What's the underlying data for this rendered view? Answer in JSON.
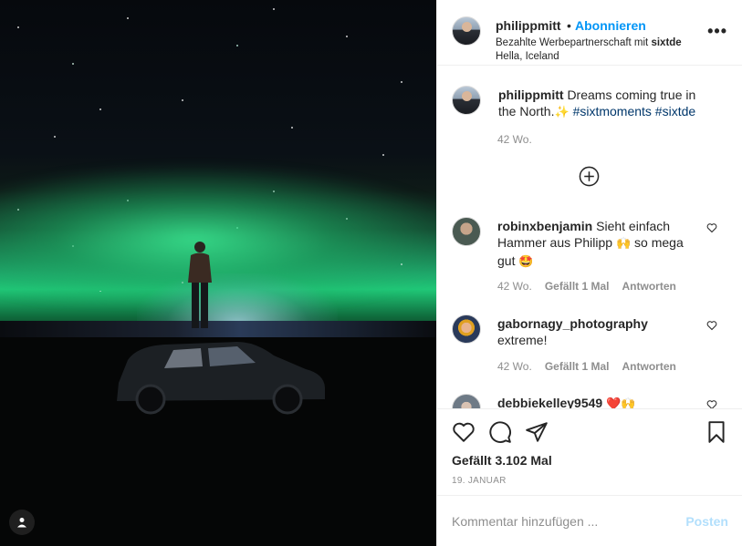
{
  "post": {
    "username": "philippmitt",
    "dot": "•",
    "follow_label": "Abonnieren",
    "sponsor_prefix": "Bezahlte Werbepartnerschaft mit",
    "sponsor": "sixtde",
    "location": "Hella, Iceland",
    "more_label": "•••",
    "caption_text": "Dreams coming true in the North.",
    "caption_emoji": "✨",
    "hashtags": "#sixtmoments #sixtde",
    "caption_time": "42 Wo."
  },
  "comments": [
    {
      "username": "robinxbenjamin",
      "text": "Sieht einfach Hammer aus Philipp",
      "emoji_mid": "🙌",
      "text_after": "so mega gut",
      "emoji_end": "🤩",
      "time": "42 Wo.",
      "likes": "Gefällt 1 Mal",
      "reply": "Antworten"
    },
    {
      "username": "gabornagy_photography",
      "text": "extreme!",
      "time": "42 Wo.",
      "likes": "Gefällt 1 Mal",
      "reply": "Antworten"
    },
    {
      "username": "debbiekelley9549",
      "emoji": "❤️🙌"
    }
  ],
  "actions": {
    "likes_count": "Gefällt 3.102 Mal",
    "date": "19. JANUAR"
  },
  "composer": {
    "placeholder": "Kommentar hinzufügen ...",
    "post_label": "Posten"
  },
  "colors": {
    "accent": "#0095f6",
    "hashtag": "#00376b",
    "muted": "#8e8e8e",
    "post_disabled": "#b2dffc"
  }
}
